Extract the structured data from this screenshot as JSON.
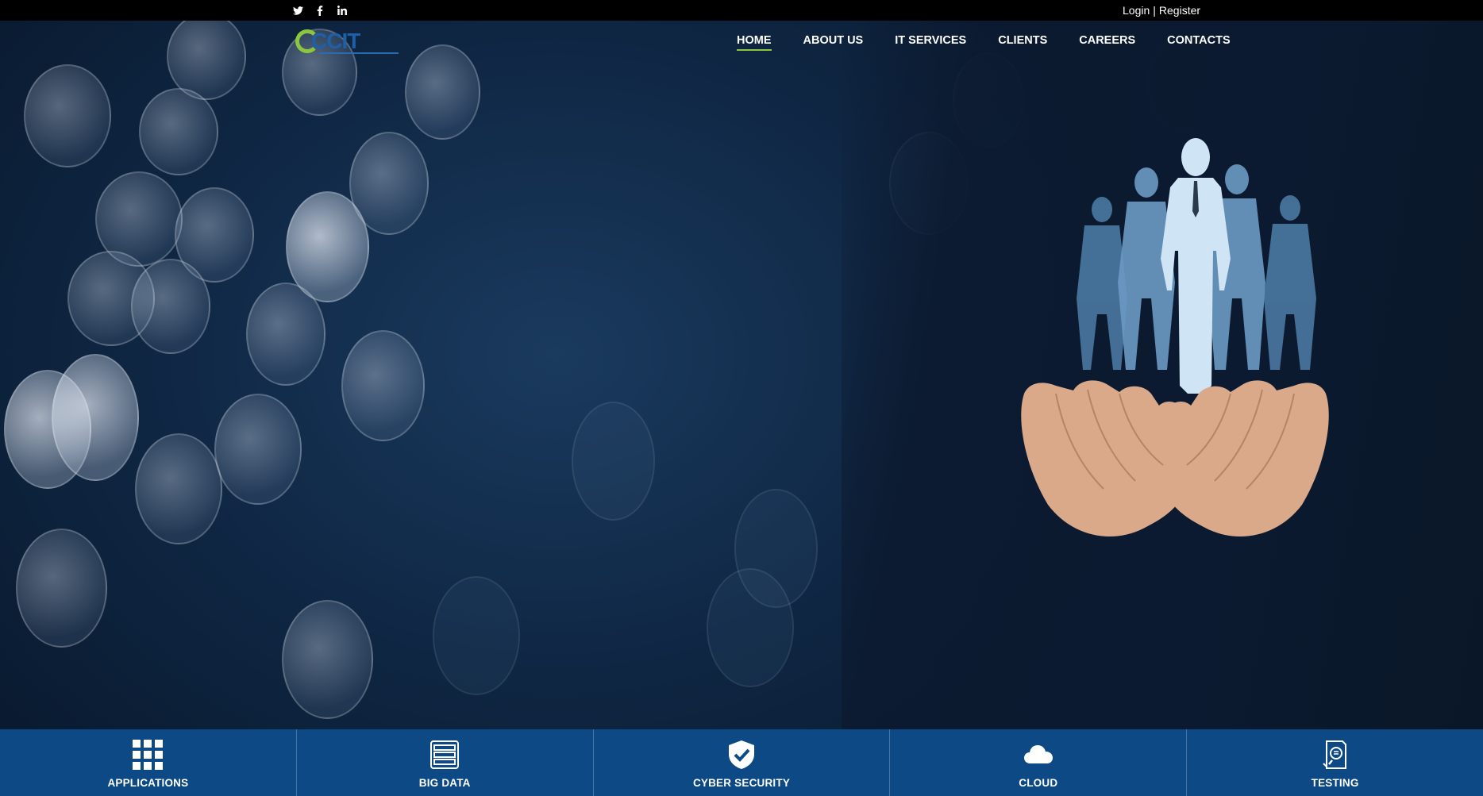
{
  "topbar": {
    "social": [
      {
        "icon": "twitter-icon",
        "glyph": "🐦"
      },
      {
        "icon": "facebook-icon",
        "glyph": "f"
      },
      {
        "icon": "linkedin-icon",
        "glyph": "in"
      }
    ],
    "login_label": "Login",
    "separator": "|",
    "register_label": "Register"
  },
  "header": {
    "logo_text": "CCIT",
    "nav": [
      {
        "label": "HOME",
        "active": true
      },
      {
        "label": "ABOUT US",
        "active": false
      },
      {
        "label": "IT SERVICES",
        "active": false
      },
      {
        "label": "CLIENTS",
        "active": false
      },
      {
        "label": "CAREERS",
        "active": false
      },
      {
        "label": "CONTACTS",
        "active": false
      }
    ]
  },
  "services": [
    {
      "label": "APPLICATIONS",
      "icon": "grid-icon"
    },
    {
      "label": "BIG DATA",
      "icon": "server-icon"
    },
    {
      "label": "CYBER SECURITY",
      "icon": "shield-check-icon"
    },
    {
      "label": "CLOUD",
      "icon": "cloud-icon"
    },
    {
      "label": "TESTING",
      "icon": "document-search-icon"
    }
  ],
  "colors": {
    "topbar_bg": "#000000",
    "accent_green": "#8cc63f",
    "logo_blue": "#1e5fa8",
    "services_bg": "#0d4a85",
    "hero_bg": "#0f2744"
  }
}
